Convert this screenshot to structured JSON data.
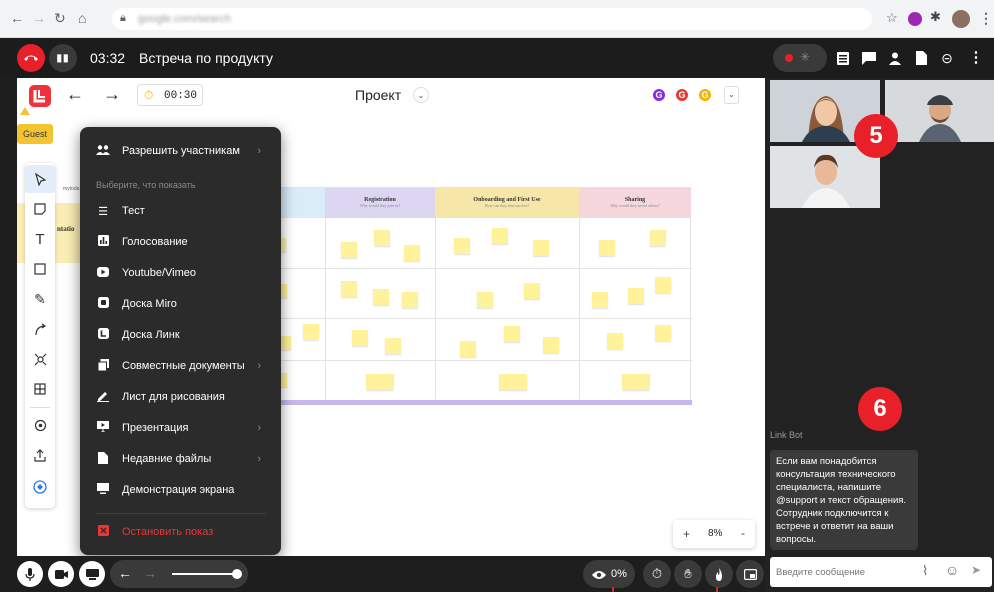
{
  "meeting": {
    "timer": "03:32",
    "title": "Встреча по продукту"
  },
  "board": {
    "title": "Проект",
    "countdown": "00:30",
    "guest_label": "Guest",
    "avatar_letters": [
      "G",
      "G",
      "G"
    ],
    "avatar_colors": [
      "#8a2be2",
      "#e53935",
      "#f4b400"
    ],
    "zoom": "8%",
    "zoom_plus": "+",
    "zoom_minus": "-",
    "grid_columns": [
      {
        "name": "Registration",
        "sub": "Why would they join us?",
        "color": "#dcd6f3"
      },
      {
        "name": "Onboarding and First Use",
        "sub": "How can they find success?",
        "color": "#f6e7a8"
      },
      {
        "name": "Sharing",
        "sub": "Why would they invite others?",
        "color": "#f6d7dd"
      }
    ],
    "partial_left_label": "ntatio",
    "partial_left_small": "mytoda"
  },
  "menu": {
    "allow_label": "Разрешить участникам",
    "section_label": "Выберите, что показать",
    "items": [
      {
        "label": "Тест",
        "icon": "list-icon",
        "arrow": false
      },
      {
        "label": "Голосование",
        "icon": "poll-icon",
        "arrow": false
      },
      {
        "label": "Youtube/Vimeo",
        "icon": "youtube-icon",
        "arrow": false
      },
      {
        "label": "Доска Miro",
        "icon": "miro-icon",
        "arrow": false
      },
      {
        "label": "Доска Линк",
        "icon": "link-board-icon",
        "arrow": false
      },
      {
        "label": "Совместные документы",
        "icon": "documents-icon",
        "arrow": true
      },
      {
        "label": "Лист для рисования",
        "icon": "pen-icon",
        "arrow": false
      },
      {
        "label": "Презентация",
        "icon": "presentation-icon",
        "arrow": true
      },
      {
        "label": "Недавние файлы",
        "icon": "file-icon",
        "arrow": true
      },
      {
        "label": "Демонстрация экрана",
        "icon": "screen-icon",
        "arrow": false
      }
    ],
    "stop_label": "Остановить показ"
  },
  "chat": {
    "bot_name": "Link Bot",
    "message": "Если вам понадобится консультация технического специалиста, напишите @support и текст обращения. Сотрудник подключится к встрече и ответит на ваши вопросы.",
    "input_placeholder": "Введите сообщение"
  },
  "annotations": {
    "badge5": "5",
    "badge6": "6"
  },
  "bottom": {
    "viewers_pct": "0%"
  },
  "colors": {
    "accent_red": "#e8202a",
    "stop_red": "#e53935",
    "logo_red": "#f0323c"
  }
}
